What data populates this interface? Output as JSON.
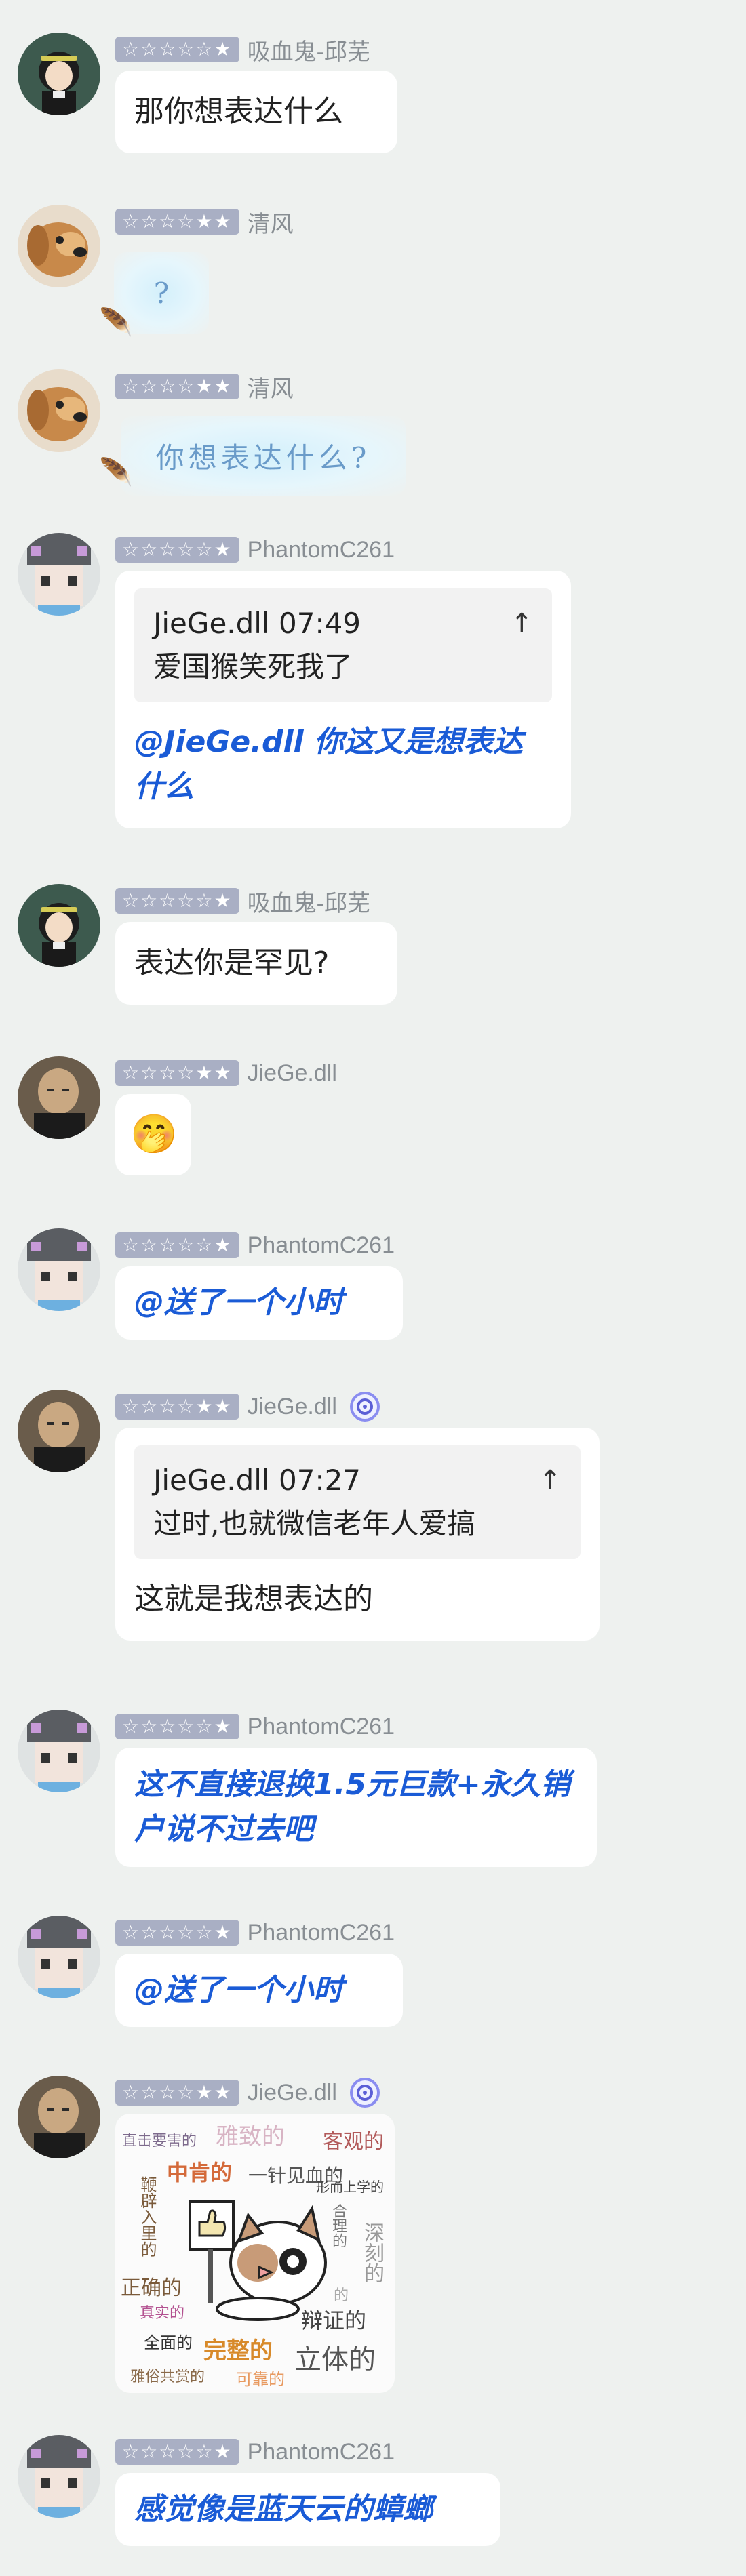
{
  "messages": [
    {
      "user": "吸血鬼-邱芜",
      "stars": "☆☆☆☆☆★",
      "text": "那你想表达什么"
    },
    {
      "user": "清风",
      "stars": "☆☆☆☆★★",
      "text": "?"
    },
    {
      "user": "清风",
      "stars": "☆☆☆☆★★",
      "text": "你想表达什么?"
    },
    {
      "user": "PhantomC261",
      "stars": "☆☆☆☆☆★",
      "quote_header": "JieGe.dll 07:49",
      "quote_arrow": "↑",
      "quote_text": "爱国猴笑死我了",
      "text": "@JieGe.dll 你这又是想表达什么"
    },
    {
      "user": "吸血鬼-邱芜",
      "stars": "☆☆☆☆☆★",
      "text": "表达你是罕见?"
    },
    {
      "user": "JieGe.dll",
      "stars": "☆☆☆☆★★",
      "emoji": "🤭"
    },
    {
      "user": "PhantomC261",
      "stars": "☆☆☆☆☆★",
      "text": "@送了一个小时"
    },
    {
      "user": "JieGe.dll",
      "stars": "☆☆☆☆★★",
      "quote_header": "JieGe.dll 07:27",
      "quote_arrow": "↑",
      "quote_text": "过时,也就微信老年人爱搞",
      "text": "这就是我想表达的"
    },
    {
      "user": "PhantomC261",
      "stars": "☆☆☆☆☆★",
      "text": "这不直接退换1.5元巨款+永久销户说不过去吧"
    },
    {
      "user": "PhantomC261",
      "stars": "☆☆☆☆☆★",
      "text": "@送了一个小时"
    },
    {
      "user": "JieGe.dll",
      "stars": "☆☆☆☆★★",
      "sticker_words": [
        "直击要害的",
        "雅致的",
        "客观的",
        "中肯的",
        "一针见血的",
        "形而上学的",
        "合理的",
        "深刻的",
        "鞭辟入里的",
        "正确的",
        "真实的",
        "全面的",
        "完整的",
        "辩证的",
        "立体的",
        "雅俗共赏的",
        "可靠的",
        "的"
      ]
    },
    {
      "user": "PhantomC261",
      "stars": "☆☆☆☆☆★",
      "text": "感觉像是蓝天云的蟑螂"
    }
  ],
  "colors": {
    "background": "#eef1ef",
    "bubble": "#ffffff",
    "mention_blue": "#1a5bd6",
    "star_badge": "#a9afc4"
  }
}
